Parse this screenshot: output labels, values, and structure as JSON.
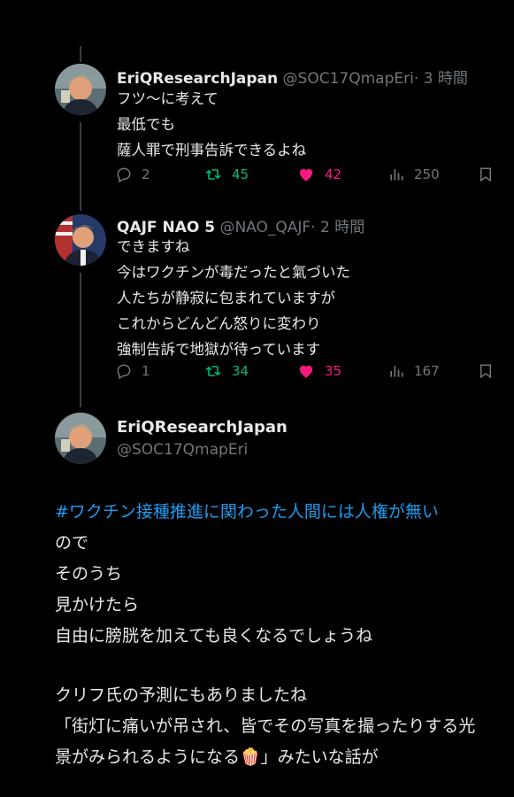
{
  "tweets": [
    {
      "name": "EriQResearchJapan",
      "handle": "@SOC17QmapEri",
      "time": "· 3 時間",
      "text": "フツ〜に考えて\n最低でも\n薩人罪で刑事告訴できるよね",
      "replies": "2",
      "retweets": "45",
      "likes": "42",
      "views": "250"
    },
    {
      "name": "QAJF NAO 5",
      "handle": "@NAO_QAJF",
      "time": "· 2 時間",
      "text": "できますね\n今はワクチンが毒だったと氣づいた\n人たちが静寂に包まれていますが\nこれからどんどん怒りに変わり\n強制告訴で地獄が待っています",
      "replies": "1",
      "retweets": "34",
      "likes": "35",
      "views": "167"
    }
  ],
  "main": {
    "name": "EriQResearchJapan",
    "handle": "@SOC17QmapEri",
    "hashtag": "#ワクチン接種推進に関わった人間には人権が無い",
    "lines": [
      "ので",
      "そのうち",
      "見かけたら",
      "自由に膀胱を加えても良くなるでしょうね",
      "",
      "クリフ氏の予測にもありましたね",
      "「街灯に痛いが吊され、皆でその写真を撮ったりする光",
      "景がみられるようになる🍿」みたいな話が"
    ]
  },
  "colors": {
    "background": "#000000",
    "text": "#e7e9ea",
    "muted": "#71767b",
    "retweet": "#00ba7c",
    "like": "#f91880",
    "link": "#1d9bf0"
  },
  "icons": {
    "reply": "reply-icon",
    "retweet": "retweet-icon",
    "like": "heart-icon",
    "views": "views-icon",
    "bookmark": "bookmark-icon"
  }
}
